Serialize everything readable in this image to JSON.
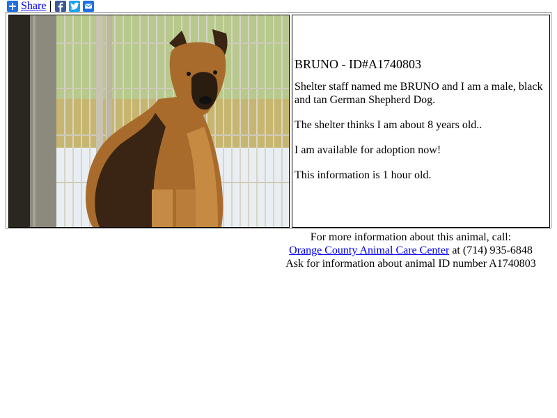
{
  "share": {
    "label": "Share",
    "icons": [
      "share-plus-icon",
      "facebook-icon",
      "twitter-icon",
      "email-icon"
    ]
  },
  "animal": {
    "title": "BRUNO - ID#A1740803",
    "paragraphs": [
      "Shelter staff named me BRUNO and I am a male, black and tan German Shepherd Dog.",
      "The shelter thinks I am about 8 years old..",
      "I am available for adoption now!",
      "This information is 1 hour old."
    ]
  },
  "footer": {
    "line1": "For more information about this animal, call:",
    "center_link": "Orange County Animal Care Center",
    "phone_text": " at (714) 935-6848",
    "line3": "Ask for information about animal ID number A1740803"
  },
  "colors": {
    "link": "#0000ee",
    "share_blue": "#1f6fe5",
    "facebook": "#3b5998",
    "twitter": "#1da1f2"
  }
}
